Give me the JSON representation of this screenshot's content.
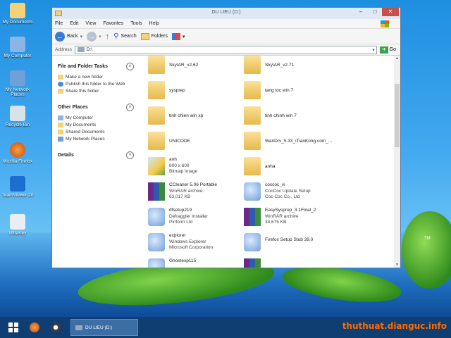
{
  "desktop": {
    "icons": [
      {
        "label": "My Documents",
        "icon": "my-documents-icon"
      },
      {
        "label": "My Computer",
        "icon": "my-computer-icon"
      },
      {
        "label": "My Network Places",
        "icon": "network-places-icon"
      },
      {
        "label": "Recycle Bin",
        "icon": "recycle-bin-icon"
      },
      {
        "label": "Mozilla Firefox",
        "icon": "firefox-icon"
      },
      {
        "label": "TeamViewer 10",
        "icon": "teamviewer-icon"
      },
      {
        "label": "UltraKey",
        "icon": "ultrakey-icon"
      }
    ],
    "tm_text": "TM"
  },
  "window": {
    "title": "DU LIEU (D:)",
    "menu": [
      "File",
      "Edit",
      "View",
      "Favorites",
      "Tools",
      "Help"
    ],
    "toolbar": {
      "back": "Back",
      "search": "Search",
      "folders": "Folders"
    },
    "address": {
      "label": "Address",
      "value": "D:\\",
      "go": "Go"
    }
  },
  "sidebar": {
    "file_tasks": {
      "title": "File and Folder Tasks",
      "items": [
        "Make a new folder",
        "Publish this folder to the Web",
        "Share this folder"
      ]
    },
    "other_places": {
      "title": "Other Places",
      "items": [
        "My Computer",
        "My Documents",
        "Shared Documents",
        "My Network Places"
      ]
    },
    "details": {
      "title": "Details"
    }
  },
  "files": [
    {
      "name": "SkyIAR_v2.62",
      "type": "folder"
    },
    {
      "name": "SkyIAR_v2.71",
      "type": "folder"
    },
    {
      "name": "sysprep",
      "type": "folder"
    },
    {
      "name": "tang toc win 7",
      "type": "folder"
    },
    {
      "name": "tinh chien win xp",
      "type": "folder"
    },
    {
      "name": "tinh chinh win 7",
      "type": "folder"
    },
    {
      "name": "UNICODE",
      "type": "folder"
    },
    {
      "name": "WanDrv_5.33_iTianKong.com_...",
      "type": "folder"
    },
    {
      "name": "anh",
      "type": "bitmap",
      "line2": "800 x 600",
      "line3": "Bitmap Image"
    },
    {
      "name": "anha",
      "type": "folder"
    },
    {
      "name": "CCleaner 5.06 Portable",
      "type": "winrar",
      "line2": "WinRAR archive",
      "line3": "63,017 KB"
    },
    {
      "name": "coccoc_vi",
      "type": "setup",
      "line2": "CocCoc Update Setup",
      "line3": "Coc Coc Co., Ltd"
    },
    {
      "name": "dfsetup219",
      "type": "setup",
      "line2": "Defraggler Installer",
      "line3": "Piriform Ltd"
    },
    {
      "name": "EasySysprep_3.1Final_2",
      "type": "winrar",
      "line2": "WinRAR archive",
      "line3": "34,675 KB"
    },
    {
      "name": "explorer",
      "type": "setup",
      "line2": "Windows Explorer",
      "line3": "Microsoft Corporation"
    },
    {
      "name": "Firefox Setup Stub 39.0",
      "type": "setup",
      "line2": "",
      "line3": ""
    },
    {
      "name": "Ghostexp115",
      "type": "setup",
      "line2": "",
      "line3": ""
    },
    {
      "name": "",
      "type": "winrar",
      "line2": "",
      "line3": ""
    }
  ],
  "taskbar": {
    "task_label": "DU LIEU (D:)",
    "watermark": "thuthuat.dianguc.info"
  },
  "colors": {
    "accent": "#1e8fe0",
    "close": "#c7504b",
    "watermark": "#ff6a00"
  }
}
